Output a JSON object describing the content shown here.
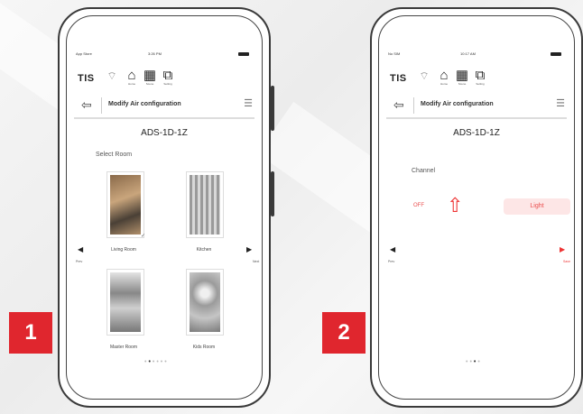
{
  "screens": [
    {
      "badge": "1",
      "status": {
        "carrier": "App Store",
        "time": "3:26 PM"
      },
      "header": {
        "logo": "TIS",
        "title": "Modify Air configuration",
        "icon_labels": [
          "Home",
          "Scene",
          "Setting"
        ]
      },
      "device_name": "ADS-1D-1Z",
      "section_label": "Select Room",
      "rooms": [
        {
          "name": "Living Room",
          "selected": true
        },
        {
          "name": "Kitchen",
          "selected": false
        },
        {
          "name": "Master Room",
          "selected": false
        },
        {
          "name": "Kids Room",
          "selected": false
        }
      ],
      "nav": {
        "prev": "Prev",
        "next": "Next"
      },
      "page_dots": {
        "total": 6,
        "active": 2
      }
    },
    {
      "badge": "2",
      "status": {
        "carrier": "No SIM",
        "time": "10:17 AM"
      },
      "header": {
        "logo": "TIS",
        "title": "Modify Air configuration",
        "icon_labels": [
          "Home",
          "Scene",
          "Setting"
        ]
      },
      "device_name": "ADS-1D-1Z",
      "channel_label": "Channel",
      "toggle": {
        "off": "OFF",
        "on": "Light"
      },
      "nav": {
        "prev": "Prev",
        "next": "Save"
      },
      "page_dots": {
        "total": 4,
        "active": 3
      }
    }
  ],
  "colors": {
    "accent": "#e0262e",
    "toggle_text": "#ea4d4d",
    "toggle_bg": "#fde6e6"
  }
}
